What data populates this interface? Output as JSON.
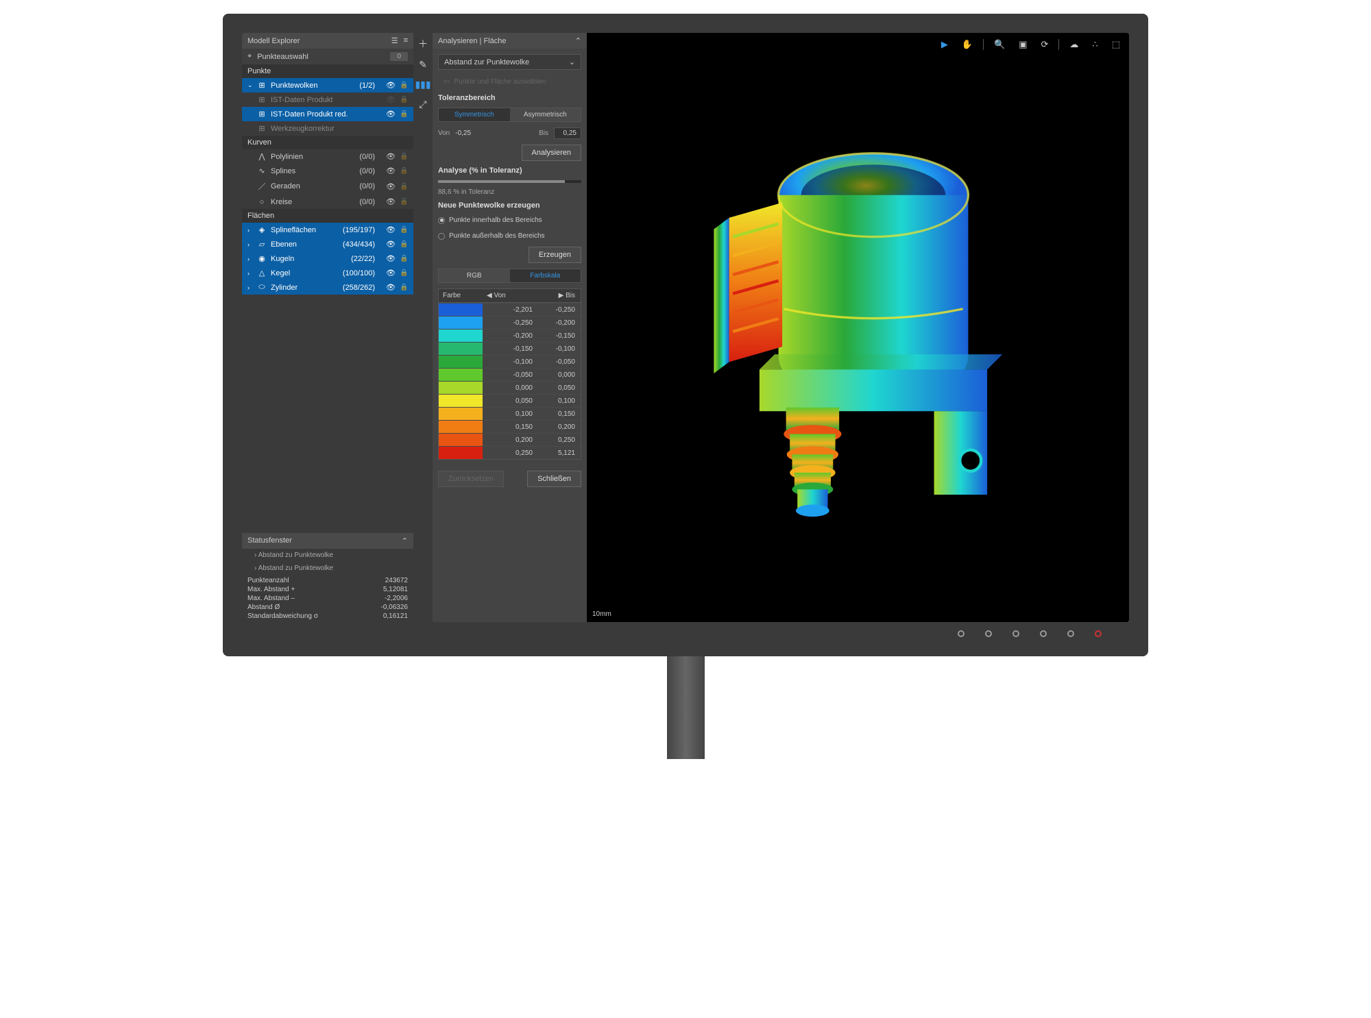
{
  "explorer": {
    "title": "Modell Explorer",
    "pointsel": {
      "label": "Punkteauswahl",
      "count": "0"
    },
    "sections": {
      "punkte": "Punkte",
      "kurven": "Kurven",
      "flaechen": "Flächen"
    },
    "pw": {
      "label": "Punktewolken",
      "count": "(1/2)"
    },
    "pw_children": [
      {
        "label": "IST-Daten Produkt"
      },
      {
        "label": "IST-Daten Produkt red."
      },
      {
        "label": "Werkzeugkorrektur"
      }
    ],
    "kurven": [
      {
        "label": "Polylinien",
        "count": "(0/0)"
      },
      {
        "label": "Splines",
        "count": "(0/0)"
      },
      {
        "label": "Geraden",
        "count": "(0/0)"
      },
      {
        "label": "Kreise",
        "count": "(0/0)"
      }
    ],
    "flaechen": [
      {
        "label": "Splineflächen",
        "count": "(195/197)"
      },
      {
        "label": "Ebenen",
        "count": "(434/434)"
      },
      {
        "label": "Kugeln",
        "count": "(22/22)"
      },
      {
        "label": "Kegel",
        "count": "(100/100)"
      },
      {
        "label": "Zylinder",
        "count": "(258/262)"
      }
    ]
  },
  "status": {
    "title": "Statusfenster",
    "items": [
      "Abstand zu Punktewolke",
      "Abstand zu Punktewolke"
    ],
    "stats": [
      {
        "label": "Punkteanzahl",
        "value": "243672"
      },
      {
        "label": "Max. Abstand +",
        "value": "5,12081"
      },
      {
        "label": "Max. Abstand –",
        "value": "-2,2006"
      },
      {
        "label": "Abstand Ø",
        "value": "-0,06326"
      },
      {
        "label": "Standardabweichung σ",
        "value": "0,16121"
      }
    ]
  },
  "analyse": {
    "title": "Analysieren | Fläche",
    "dropdown": "Abstand zur Punktewolke",
    "hint": "Punkte und Fläche auswählen",
    "toleranz": {
      "label": "Toleranzbereich",
      "sym": "Symmetrisch",
      "asym": "Asymmetrisch",
      "von_label": "Von",
      "von": "-0,25",
      "bis_label": "Bis",
      "bis": "0,25"
    },
    "analyse_btn": "Analysieren",
    "prozent": {
      "label": "Analyse (% in Toleranz)",
      "result": "88,6 % in Toleranz"
    },
    "neue": {
      "label": "Neue Punktewolke erzeugen",
      "inner": "Punkte innerhalb des Bereichs",
      "outer": "Punkte außerhalb des Bereichs",
      "btn": "Erzeugen"
    },
    "color_tabs": {
      "rgb": "RGB",
      "scale": "Farbskala"
    },
    "color_head": {
      "farbe": "Farbe",
      "von": "Von",
      "bis": "Bis"
    },
    "colors": [
      {
        "hex": "#1b5fd8",
        "von": "-2,201",
        "bis": "-0,250"
      },
      {
        "hex": "#1ea0f0",
        "von": "-0,250",
        "bis": "-0,200"
      },
      {
        "hex": "#1fd6d0",
        "von": "-0,200",
        "bis": "-0,150"
      },
      {
        "hex": "#26b86f",
        "von": "-0,150",
        "bis": "-0,100"
      },
      {
        "hex": "#2aa839",
        "von": "-0,100",
        "bis": "-0,050"
      },
      {
        "hex": "#5fc82c",
        "von": "-0,050",
        "bis": "0,000"
      },
      {
        "hex": "#a8d82a",
        "von": "0,000",
        "bis": "0,050"
      },
      {
        "hex": "#f0e62a",
        "von": "0,050",
        "bis": "0,100"
      },
      {
        "hex": "#f5b01e",
        "von": "0,100",
        "bis": "0,150"
      },
      {
        "hex": "#f07d14",
        "von": "0,150",
        "bis": "0,200"
      },
      {
        "hex": "#e85512",
        "von": "0,200",
        "bis": "0,250"
      },
      {
        "hex": "#d82010",
        "von": "0,250",
        "bis": "5,121"
      }
    ],
    "reset": "Zurücksetzen",
    "close": "Schließen"
  },
  "viewport": {
    "scale": "10mm"
  }
}
